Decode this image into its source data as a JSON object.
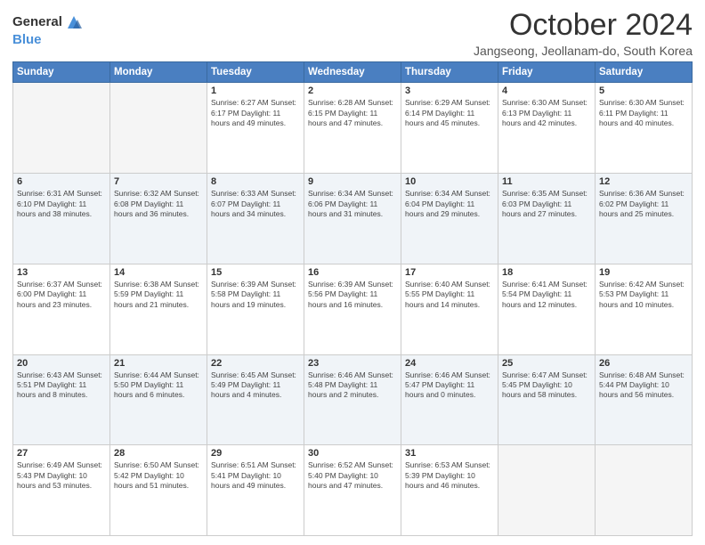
{
  "logo": {
    "text_general": "General",
    "text_blue": "Blue"
  },
  "header": {
    "month_title": "October 2024",
    "subtitle": "Jangseong, Jeollanam-do, South Korea"
  },
  "weekdays": [
    "Sunday",
    "Monday",
    "Tuesday",
    "Wednesday",
    "Thursday",
    "Friday",
    "Saturday"
  ],
  "weeks": [
    [
      {
        "day": "",
        "info": ""
      },
      {
        "day": "",
        "info": ""
      },
      {
        "day": "1",
        "info": "Sunrise: 6:27 AM\nSunset: 6:17 PM\nDaylight: 11 hours and 49 minutes."
      },
      {
        "day": "2",
        "info": "Sunrise: 6:28 AM\nSunset: 6:15 PM\nDaylight: 11 hours and 47 minutes."
      },
      {
        "day": "3",
        "info": "Sunrise: 6:29 AM\nSunset: 6:14 PM\nDaylight: 11 hours and 45 minutes."
      },
      {
        "day": "4",
        "info": "Sunrise: 6:30 AM\nSunset: 6:13 PM\nDaylight: 11 hours and 42 minutes."
      },
      {
        "day": "5",
        "info": "Sunrise: 6:30 AM\nSunset: 6:11 PM\nDaylight: 11 hours and 40 minutes."
      }
    ],
    [
      {
        "day": "6",
        "info": "Sunrise: 6:31 AM\nSunset: 6:10 PM\nDaylight: 11 hours and 38 minutes."
      },
      {
        "day": "7",
        "info": "Sunrise: 6:32 AM\nSunset: 6:08 PM\nDaylight: 11 hours and 36 minutes."
      },
      {
        "day": "8",
        "info": "Sunrise: 6:33 AM\nSunset: 6:07 PM\nDaylight: 11 hours and 34 minutes."
      },
      {
        "day": "9",
        "info": "Sunrise: 6:34 AM\nSunset: 6:06 PM\nDaylight: 11 hours and 31 minutes."
      },
      {
        "day": "10",
        "info": "Sunrise: 6:34 AM\nSunset: 6:04 PM\nDaylight: 11 hours and 29 minutes."
      },
      {
        "day": "11",
        "info": "Sunrise: 6:35 AM\nSunset: 6:03 PM\nDaylight: 11 hours and 27 minutes."
      },
      {
        "day": "12",
        "info": "Sunrise: 6:36 AM\nSunset: 6:02 PM\nDaylight: 11 hours and 25 minutes."
      }
    ],
    [
      {
        "day": "13",
        "info": "Sunrise: 6:37 AM\nSunset: 6:00 PM\nDaylight: 11 hours and 23 minutes."
      },
      {
        "day": "14",
        "info": "Sunrise: 6:38 AM\nSunset: 5:59 PM\nDaylight: 11 hours and 21 minutes."
      },
      {
        "day": "15",
        "info": "Sunrise: 6:39 AM\nSunset: 5:58 PM\nDaylight: 11 hours and 19 minutes."
      },
      {
        "day": "16",
        "info": "Sunrise: 6:39 AM\nSunset: 5:56 PM\nDaylight: 11 hours and 16 minutes."
      },
      {
        "day": "17",
        "info": "Sunrise: 6:40 AM\nSunset: 5:55 PM\nDaylight: 11 hours and 14 minutes."
      },
      {
        "day": "18",
        "info": "Sunrise: 6:41 AM\nSunset: 5:54 PM\nDaylight: 11 hours and 12 minutes."
      },
      {
        "day": "19",
        "info": "Sunrise: 6:42 AM\nSunset: 5:53 PM\nDaylight: 11 hours and 10 minutes."
      }
    ],
    [
      {
        "day": "20",
        "info": "Sunrise: 6:43 AM\nSunset: 5:51 PM\nDaylight: 11 hours and 8 minutes."
      },
      {
        "day": "21",
        "info": "Sunrise: 6:44 AM\nSunset: 5:50 PM\nDaylight: 11 hours and 6 minutes."
      },
      {
        "day": "22",
        "info": "Sunrise: 6:45 AM\nSunset: 5:49 PM\nDaylight: 11 hours and 4 minutes."
      },
      {
        "day": "23",
        "info": "Sunrise: 6:46 AM\nSunset: 5:48 PM\nDaylight: 11 hours and 2 minutes."
      },
      {
        "day": "24",
        "info": "Sunrise: 6:46 AM\nSunset: 5:47 PM\nDaylight: 11 hours and 0 minutes."
      },
      {
        "day": "25",
        "info": "Sunrise: 6:47 AM\nSunset: 5:45 PM\nDaylight: 10 hours and 58 minutes."
      },
      {
        "day": "26",
        "info": "Sunrise: 6:48 AM\nSunset: 5:44 PM\nDaylight: 10 hours and 56 minutes."
      }
    ],
    [
      {
        "day": "27",
        "info": "Sunrise: 6:49 AM\nSunset: 5:43 PM\nDaylight: 10 hours and 53 minutes."
      },
      {
        "day": "28",
        "info": "Sunrise: 6:50 AM\nSunset: 5:42 PM\nDaylight: 10 hours and 51 minutes."
      },
      {
        "day": "29",
        "info": "Sunrise: 6:51 AM\nSunset: 5:41 PM\nDaylight: 10 hours and 49 minutes."
      },
      {
        "day": "30",
        "info": "Sunrise: 6:52 AM\nSunset: 5:40 PM\nDaylight: 10 hours and 47 minutes."
      },
      {
        "day": "31",
        "info": "Sunrise: 6:53 AM\nSunset: 5:39 PM\nDaylight: 10 hours and 46 minutes."
      },
      {
        "day": "",
        "info": ""
      },
      {
        "day": "",
        "info": ""
      }
    ]
  ]
}
